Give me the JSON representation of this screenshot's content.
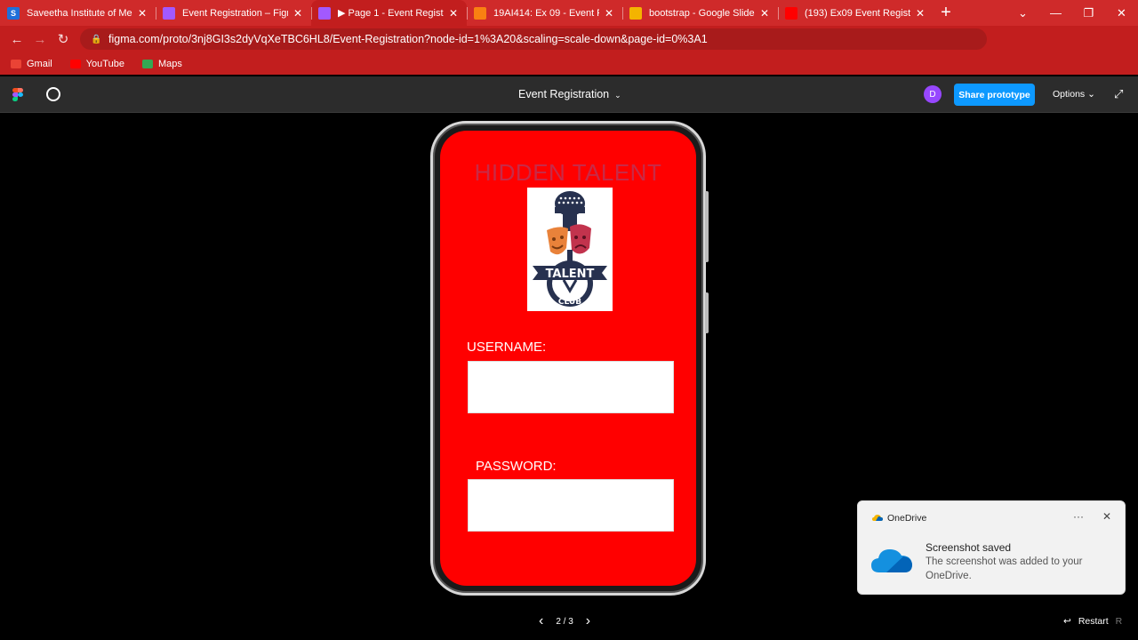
{
  "browser": {
    "tabs": [
      {
        "title": "Saveetha Institute of Medic",
        "favicon": "saveetha-icon",
        "color": "#1e6fd9",
        "glyph": "S"
      },
      {
        "title": "Event Registration – Figma",
        "favicon": "figma-icon",
        "color": "#a259ff",
        "glyph": ""
      },
      {
        "title": "▶ Page 1 - Event Registratic",
        "favicon": "figma-icon",
        "color": "#a259ff",
        "glyph": "",
        "active": true
      },
      {
        "title": "19AI414: Ex 09 - Event Regi",
        "favicon": "moodle-icon",
        "color": "#f98012",
        "glyph": ""
      },
      {
        "title": "bootstrap - Google Slides",
        "favicon": "slides-icon",
        "color": "#f4b400",
        "glyph": ""
      },
      {
        "title": "(193) Ex09 Event Registratic",
        "favicon": "youtube-icon",
        "color": "#ff0000",
        "glyph": ""
      }
    ],
    "url": "figma.com/proto/3nj8GI3s2dyVqXeTBC6HL8/Event-Registration?node-id=1%3A20&scaling=scale-down&page-id=0%3A1",
    "bookmarks": [
      {
        "label": "Gmail",
        "icon": "gmail-icon",
        "color": "#ea4335"
      },
      {
        "label": "YouTube",
        "icon": "youtube-icon",
        "color": "#ff0000"
      },
      {
        "label": "Maps",
        "icon": "maps-icon",
        "color": "#34a853"
      }
    ]
  },
  "figma": {
    "file_title": "Event Registration",
    "avatar_initial": "D",
    "share_label": "Share prototype",
    "options_label": "Options",
    "page_indicator": "2 / 3",
    "restart_label": "Restart",
    "restart_key": "R"
  },
  "app": {
    "title": "HIDDEN TALENT",
    "logo_text_top": "TALENT",
    "logo_text_bottom": "CLUB",
    "username_label": "USERNAME:",
    "username_value": "",
    "password_label": "PASSWORD:",
    "password_value": "",
    "screen_color": "#ff0000",
    "title_color": "#c82a47"
  },
  "toast": {
    "app_name": "OneDrive",
    "title": "Screenshot saved",
    "message": "The screenshot was added to your OneDrive."
  }
}
